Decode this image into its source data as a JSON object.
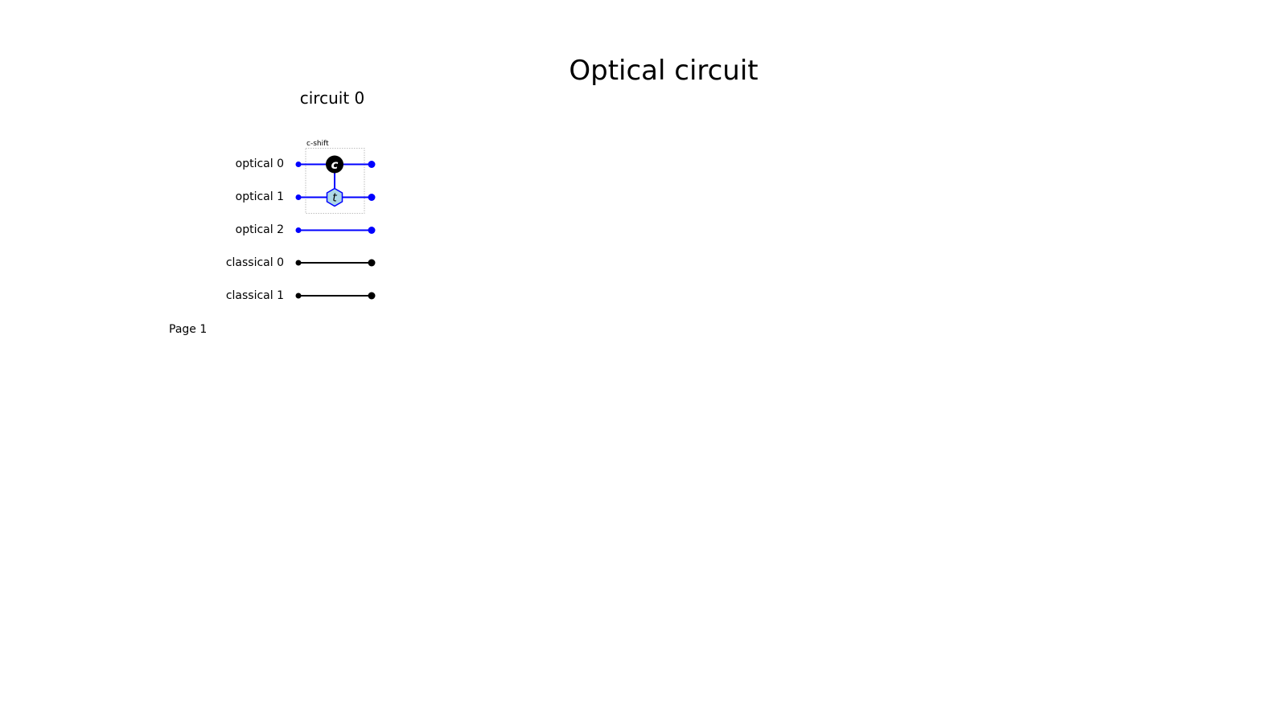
{
  "page": {
    "title": "Optical circuit",
    "page_label": "Page 1"
  },
  "circuit": {
    "title": "circuit 0",
    "wires": [
      {
        "label": "optical 0",
        "kind": "optical"
      },
      {
        "label": "optical 1",
        "kind": "optical"
      },
      {
        "label": "optical 2",
        "kind": "optical"
      },
      {
        "label": "classical 0",
        "kind": "classical"
      },
      {
        "label": "classical 1",
        "kind": "classical"
      }
    ],
    "gates": [
      {
        "label": "c-shift",
        "control": {
          "wire": 0,
          "symbol": "c"
        },
        "target": {
          "wire": 1,
          "symbol": "t"
        }
      }
    ]
  },
  "colors": {
    "optical_wire": "#0000ff",
    "classical_wire": "#000000",
    "control_node": "#000000",
    "target_node_fill": "#add8e6",
    "target_node_stroke": "#0000ff",
    "gate_box_border": "#aaaaaa"
  }
}
